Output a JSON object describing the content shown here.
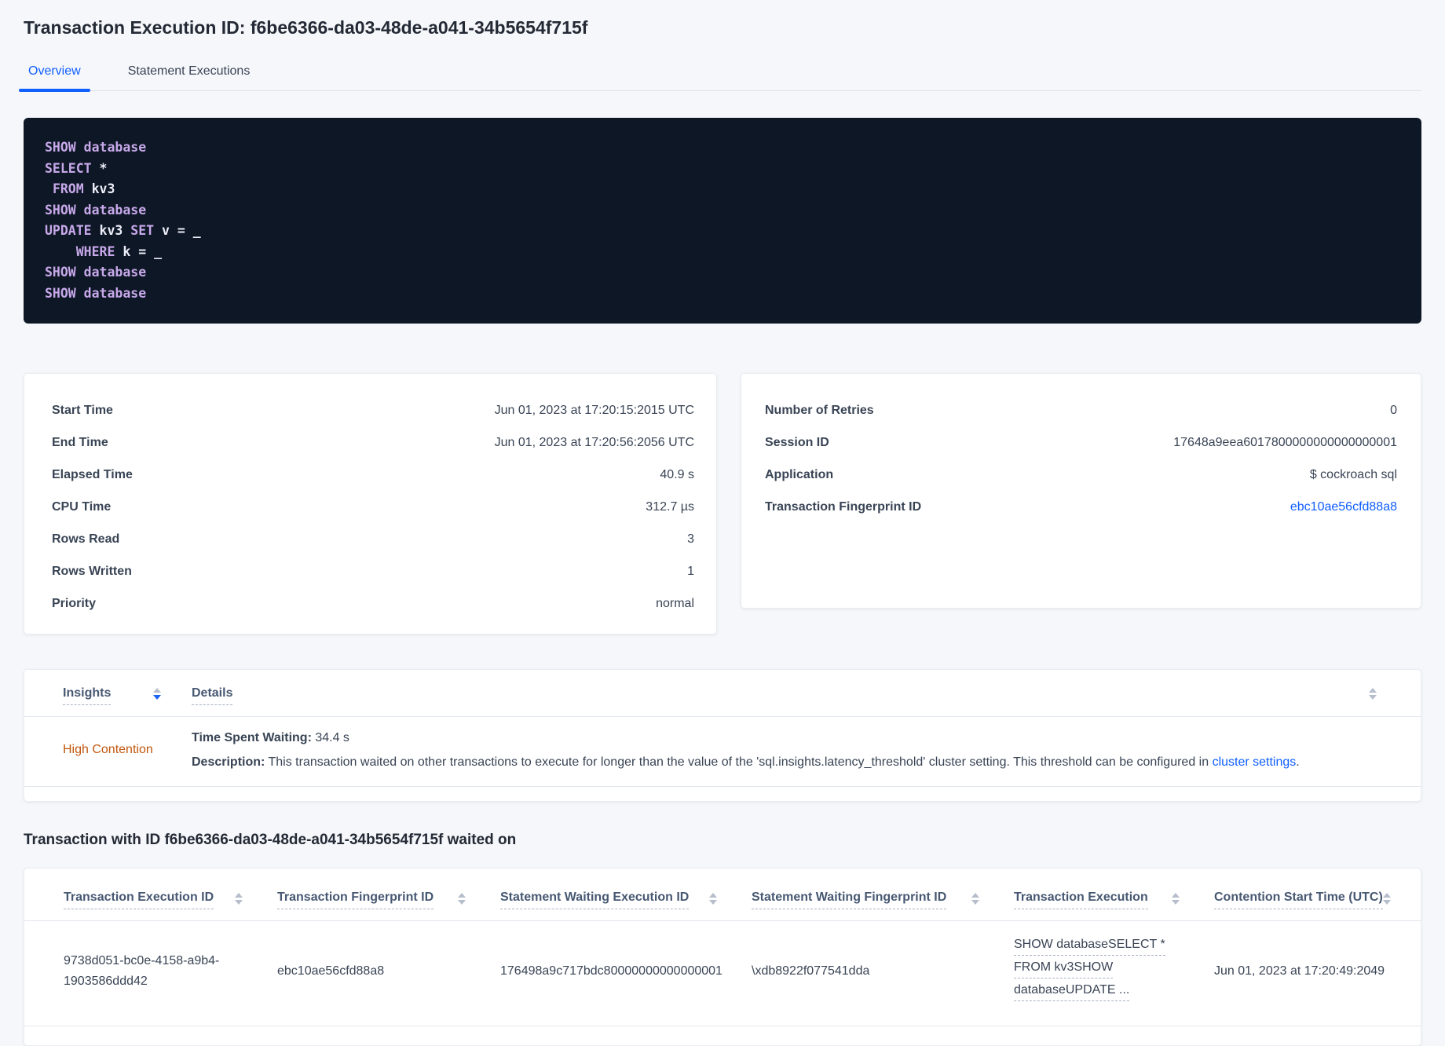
{
  "page": {
    "title": "Transaction Execution ID: f6be6366-da03-48de-a041-34b5654f715f"
  },
  "tabs": {
    "overview": "Overview",
    "statement_executions": "Statement Executions"
  },
  "colors": {
    "accent_blue": "#0f5eff",
    "insight_orange": "#c2570e",
    "code_background": "#0e1726",
    "code_keyword": "#c7a9ea"
  },
  "sql_box": {
    "lines": [
      {
        "segs": [
          {
            "t": "SHOW database"
          }
        ]
      },
      {
        "segs": [
          {
            "t": "SELECT"
          },
          {
            "t": " *"
          }
        ]
      },
      {
        "segs": [
          {
            "t": " "
          },
          {
            "t": "FROM"
          },
          {
            "t": " kv3"
          }
        ]
      },
      {
        "segs": [
          {
            "t": "SHOW database"
          }
        ]
      },
      {
        "segs": [
          {
            "t": "UPDATE"
          },
          {
            "t": " kv3 "
          },
          {
            "t": "SET"
          },
          {
            "t": " v = _"
          }
        ]
      },
      {
        "segs": [
          {
            "t": "    "
          },
          {
            "t": "WHERE"
          },
          {
            "t": " k = _"
          }
        ]
      },
      {
        "segs": [
          {
            "t": "SHOW database"
          }
        ]
      },
      {
        "segs": [
          {
            "t": "SHOW database"
          }
        ]
      }
    ]
  },
  "summary_left": {
    "rows": [
      {
        "label": "Start Time",
        "value": "Jun 01, 2023 at 17:20:15:2015 UTC"
      },
      {
        "label": "End Time",
        "value": "Jun 01, 2023 at 17:20:56:2056 UTC"
      },
      {
        "label": "Elapsed Time",
        "value": "40.9 s"
      },
      {
        "label": "CPU Time",
        "value": "312.7 µs"
      },
      {
        "label": "Rows Read",
        "value": "3"
      },
      {
        "label": "Rows Written",
        "value": "1"
      },
      {
        "label": "Priority",
        "value": "normal"
      }
    ]
  },
  "summary_right": {
    "rows": [
      {
        "label": "Number of Retries",
        "value": "0"
      },
      {
        "label": "Session ID",
        "value": "17648a9eea6017800000000000000001"
      },
      {
        "label": "Application",
        "value": "$ cockroach sql"
      }
    ],
    "fingerprint_label": "Transaction Fingerprint ID",
    "fingerprint_value": "ebc10ae56cfd88a8"
  },
  "insights": {
    "col_insights": "Insights",
    "col_details": "Details",
    "row": {
      "insight": "High Contention",
      "waiting_label": "Time Spent Waiting:",
      "waiting_value": " 34.4 s",
      "description_label": "Description:",
      "description_text": " This transaction waited on other transactions to execute for longer than the value of the 'sql.insights.latency_threshold' cluster setting. This threshold can be configured in ",
      "description_link": "cluster settings",
      "description_end": "."
    }
  },
  "waited_on": {
    "heading": "Transaction with ID f6be6366-da03-48de-a041-34b5654f715f waited on",
    "columns": [
      "Transaction Execution ID",
      "Transaction Fingerprint ID",
      "Statement Waiting Execution ID",
      "Statement Waiting Fingerprint ID",
      "Transaction Execution",
      "Contention Start Time (UTC)"
    ],
    "row": {
      "txn_execution_id": "9738d051-bc0e-4158-a9b4-1903586ddd42",
      "txn_fingerprint_id": "ebc10ae56cfd88a8",
      "stmt_waiting_execution_id": "176498a9c717bdc80000000000000001",
      "stmt_waiting_fingerprint_id": "\\xdb8922f077541dda",
      "txn_execution_lines": [
        "SHOW databaseSELECT *",
        "FROM kv3SHOW",
        "databaseUPDATE ..."
      ],
      "contention_start_time": "Jun 01, 2023 at 17:20:49:2049"
    }
  }
}
